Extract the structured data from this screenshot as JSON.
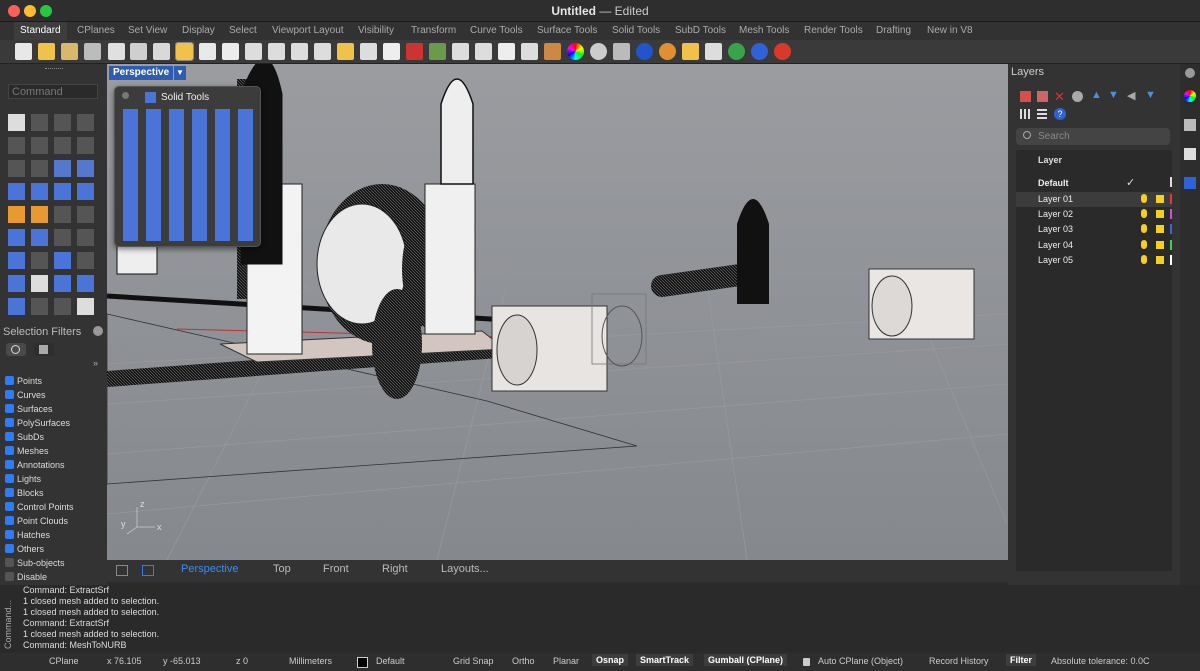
{
  "window": {
    "title": "Untitled",
    "status": "Edited"
  },
  "tabs": [
    "Standard",
    "CPlanes",
    "Set View",
    "Display",
    "Select",
    "Viewport Layout",
    "Visibility",
    "Transform",
    "Curve Tools",
    "Surface Tools",
    "Solid Tools",
    "SubD Tools",
    "Mesh Tools",
    "Render Tools",
    "Drafting",
    "New in V8"
  ],
  "command": {
    "placeholder": "Command"
  },
  "viewport": {
    "label": "Perspective",
    "axis_x": "x",
    "axis_y": "y",
    "axis_z": "z"
  },
  "solid_tools": {
    "title": "Solid Tools"
  },
  "selection_filters": {
    "title": "Selection Filters",
    "items": [
      {
        "label": "Points",
        "checked": true
      },
      {
        "label": "Curves",
        "checked": true
      },
      {
        "label": "Surfaces",
        "checked": true
      },
      {
        "label": "PolySurfaces",
        "checked": true
      },
      {
        "label": "SubDs",
        "checked": true
      },
      {
        "label": "Meshes",
        "checked": true
      },
      {
        "label": "Annotations",
        "checked": true
      },
      {
        "label": "Lights",
        "checked": true
      },
      {
        "label": "Blocks",
        "checked": true
      },
      {
        "label": "Control Points",
        "checked": true
      },
      {
        "label": "Point Clouds",
        "checked": true
      },
      {
        "label": "Hatches",
        "checked": true
      },
      {
        "label": "Others",
        "checked": true
      },
      {
        "label": "Sub-objects",
        "checked": false
      },
      {
        "label": "Disable",
        "checked": false
      }
    ]
  },
  "viewport_tabs": [
    "Perspective",
    "Top",
    "Front",
    "Right",
    "Layouts..."
  ],
  "history_label": "Command...",
  "command_history": [
    "Command: ExtractSrf",
    "1 closed mesh added to selection.",
    "1 closed mesh added to selection.",
    "Command: ExtractSrf",
    "1 closed mesh added to selection.",
    "Command: MeshToNURB"
  ],
  "layers": {
    "title": "Layers",
    "search_placeholder": "Search",
    "column_header": "Layer",
    "items": [
      {
        "name": "Default",
        "current": true,
        "color": "#000000"
      },
      {
        "name": "Layer 01",
        "current": false,
        "color": "#e03a3a"
      },
      {
        "name": "Layer 02",
        "current": false,
        "color": "#d44fd8"
      },
      {
        "name": "Layer 03",
        "current": false,
        "color": "#3a63e0"
      },
      {
        "name": "Layer 04",
        "current": false,
        "color": "#3ad44f"
      },
      {
        "name": "Layer 05",
        "current": false,
        "color": "#ffffff"
      }
    ]
  },
  "statusbar": {
    "cplane": "CPlane",
    "x": "x 76.105",
    "y": "y -65.013",
    "z": "z 0",
    "units": "Millimeters",
    "layer": "Default",
    "grid_snap": "Grid Snap",
    "ortho": "Ortho",
    "planar": "Planar",
    "osnap": "Osnap",
    "smarttrack": "SmartTrack",
    "gumball": "Gumball (CPlane)",
    "auto_cplane": "Auto CPlane (Object)",
    "record_history": "Record History",
    "filter": "Filter",
    "tolerance": "Absolute tolerance: 0.0C"
  },
  "colors": {
    "accent": "#2f7cf6",
    "viewport_bg": "#8e9196",
    "panel": "#333333"
  }
}
